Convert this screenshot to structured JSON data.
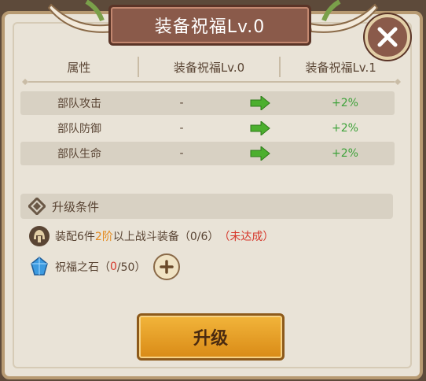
{
  "title": "装备祝福Lv.0",
  "table": {
    "headers": [
      "属性",
      "装备祝福Lv.0",
      "装备祝福Lv.1"
    ],
    "rows": [
      {
        "name": "部队攻击",
        "current": "-",
        "next": "+2%"
      },
      {
        "name": "部队防御",
        "current": "-",
        "next": "+2%"
      },
      {
        "name": "部队生命",
        "current": "-",
        "next": "+2%"
      }
    ]
  },
  "conditions": {
    "header": "升级条件",
    "equip_req": {
      "prefix": "装配6件",
      "highlight": "2阶",
      "suffix": "以上战斗装备（0/6）",
      "status": "（未达成）"
    },
    "stone_req": {
      "label": "祝福之石（",
      "have": "0",
      "need": "/50）"
    }
  },
  "upgrade_button": "升级",
  "colors": {
    "panel_bg": "#e9e3d7",
    "accent_green": "#3ea23a",
    "accent_orange": "#e48a1f",
    "accent_red": "#d6382c",
    "button_gold": "#e9a12a"
  },
  "icons": [
    "close-icon",
    "arrow-right-icon",
    "diamond-icon",
    "helmet-icon",
    "blue-gem-icon",
    "plus-icon"
  ]
}
